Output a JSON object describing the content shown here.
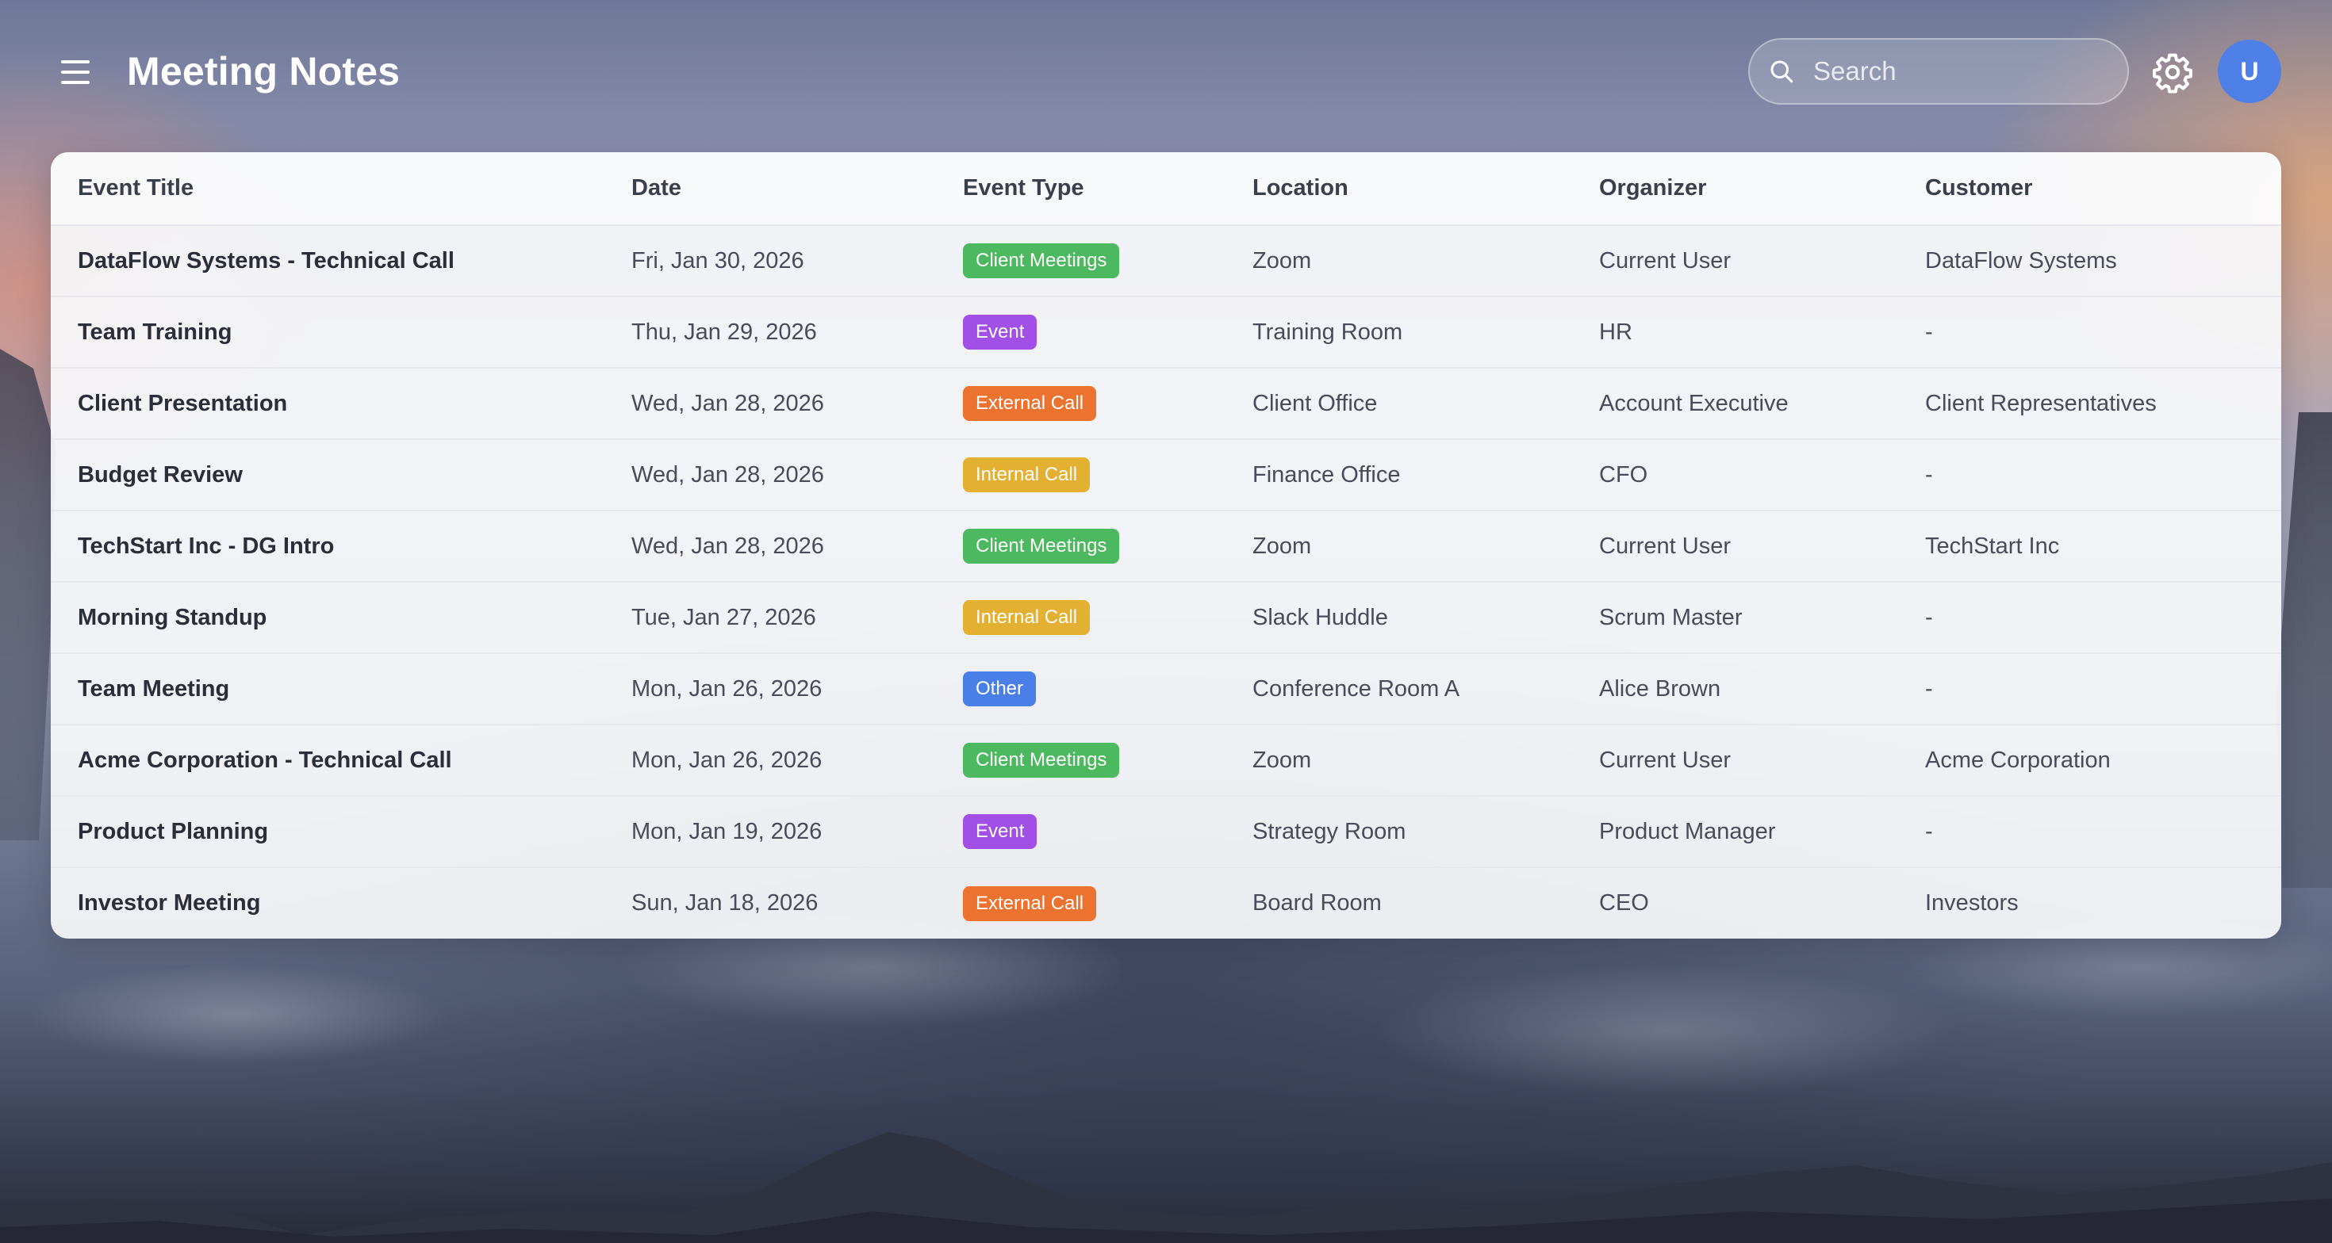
{
  "header": {
    "title": "Meeting Notes",
    "search_placeholder": "Search",
    "search_value": "",
    "avatar_initial": "U"
  },
  "icons": {
    "menu": "menu-icon",
    "search": "search-icon",
    "settings": "gear-icon"
  },
  "colors": {
    "avatar": "#4e7fe6",
    "badge_client_meetings": "#4cb960",
    "badge_event": "#a24fe8",
    "badge_external_call": "#ec7230",
    "badge_internal_call": "#e3b032",
    "badge_other": "#4a7fe8"
  },
  "table": {
    "columns": [
      "Event Title",
      "Date",
      "Event Type",
      "Location",
      "Organizer",
      "Customer"
    ],
    "rows": [
      {
        "title": "DataFlow Systems - Technical Call",
        "date": "Fri, Jan 30, 2026",
        "type": "Client Meetings",
        "type_color": "#4cb960",
        "location": "Zoom",
        "organizer": "Current User",
        "customer": "DataFlow Systems"
      },
      {
        "title": "Team Training",
        "date": "Thu, Jan 29, 2026",
        "type": "Event",
        "type_color": "#a24fe8",
        "location": "Training Room",
        "organizer": "HR",
        "customer": "-"
      },
      {
        "title": "Client Presentation",
        "date": "Wed, Jan 28, 2026",
        "type": "External Call",
        "type_color": "#ec7230",
        "location": "Client Office",
        "organizer": "Account Executive",
        "customer": "Client Representatives"
      },
      {
        "title": "Budget Review",
        "date": "Wed, Jan 28, 2026",
        "type": "Internal Call",
        "type_color": "#e3b032",
        "location": "Finance Office",
        "organizer": "CFO",
        "customer": "-"
      },
      {
        "title": "TechStart Inc - DG Intro",
        "date": "Wed, Jan 28, 2026",
        "type": "Client Meetings",
        "type_color": "#4cb960",
        "location": "Zoom",
        "organizer": "Current User",
        "customer": "TechStart Inc"
      },
      {
        "title": "Morning Standup",
        "date": "Tue, Jan 27, 2026",
        "type": "Internal Call",
        "type_color": "#e3b032",
        "location": "Slack Huddle",
        "organizer": "Scrum Master",
        "customer": "-"
      },
      {
        "title": "Team Meeting",
        "date": "Mon, Jan 26, 2026",
        "type": "Other",
        "type_color": "#4a7fe8",
        "location": "Conference Room A",
        "organizer": "Alice Brown",
        "customer": "-"
      },
      {
        "title": "Acme Corporation - Technical Call",
        "date": "Mon, Jan 26, 2026",
        "type": "Client Meetings",
        "type_color": "#4cb960",
        "location": "Zoom",
        "organizer": "Current User",
        "customer": "Acme Corporation"
      },
      {
        "title": "Product Planning",
        "date": "Mon, Jan 19, 2026",
        "type": "Event",
        "type_color": "#a24fe8",
        "location": "Strategy Room",
        "organizer": "Product Manager",
        "customer": "-"
      },
      {
        "title": "Investor Meeting",
        "date": "Sun, Jan 18, 2026",
        "type": "External Call",
        "type_color": "#ec7230",
        "location": "Board Room",
        "organizer": "CEO",
        "customer": "Investors"
      }
    ]
  }
}
